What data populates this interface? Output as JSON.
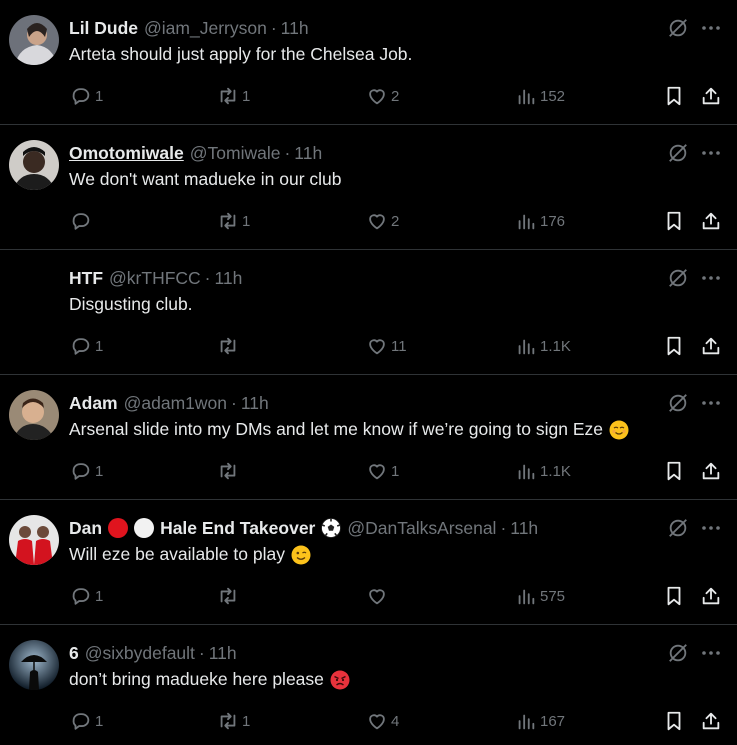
{
  "tweets": [
    {
      "name": "Lil Dude",
      "handle": "@iam_Jerryson",
      "time": "11h",
      "text": "Arteta should just apply for the Chelsea Job.",
      "replies": "1",
      "retweets": "1",
      "likes": "2",
      "views": "152",
      "avatar_color": "#8a8f99"
    },
    {
      "name": "Omotomiwale",
      "handle": "@Tomiwale",
      "time": "11h",
      "text": "We don't want madueke in our club",
      "replies": "",
      "retweets": "1",
      "likes": "2",
      "views": "176",
      "avatar_color": "#c9c6c2"
    },
    {
      "name": "HTF",
      "handle": "@krTHFCC",
      "time": "11h",
      "text": "Disgusting club.",
      "replies": "1",
      "retweets": "",
      "likes": "11",
      "views": "1.1K",
      "avatar_color": "#000000"
    },
    {
      "name": "Adam",
      "handle": "@adam1won",
      "time": "11h",
      "text": "Arsenal slide into my DMs and let me know if we’re going to sign Eze",
      "text_emoji": "relieved-face-emoji",
      "replies": "1",
      "retweets": "",
      "likes": "1",
      "views": "1.1K",
      "avatar_color": "#7a6a5a"
    },
    {
      "name": "Dan",
      "name_suffix": "Hale End Takeover",
      "handle": "@DanTalksArsenal",
      "time": "11h",
      "text": "Will eze be available to play",
      "text_emoji": "winking-face-emoji",
      "replies": "1",
      "retweets": "",
      "likes": "",
      "views": "575",
      "avatar_color": "#e0e0e0",
      "badge_colors": [
        "#e0141e",
        "#ffffff"
      ]
    },
    {
      "name": "6",
      "handle": "@sixbydefault",
      "time": "11h",
      "text": "don’t bring madueke here please",
      "text_emoji": "angry-face-emoji",
      "replies": "1",
      "retweets": "1",
      "likes": "4",
      "views": "167",
      "avatar_color": "#2a4a66"
    }
  ],
  "separator": "·",
  "colors": {
    "text": "#e7e9ea",
    "muted": "#71767b",
    "border": "#2f3336",
    "background": "#000000"
  }
}
